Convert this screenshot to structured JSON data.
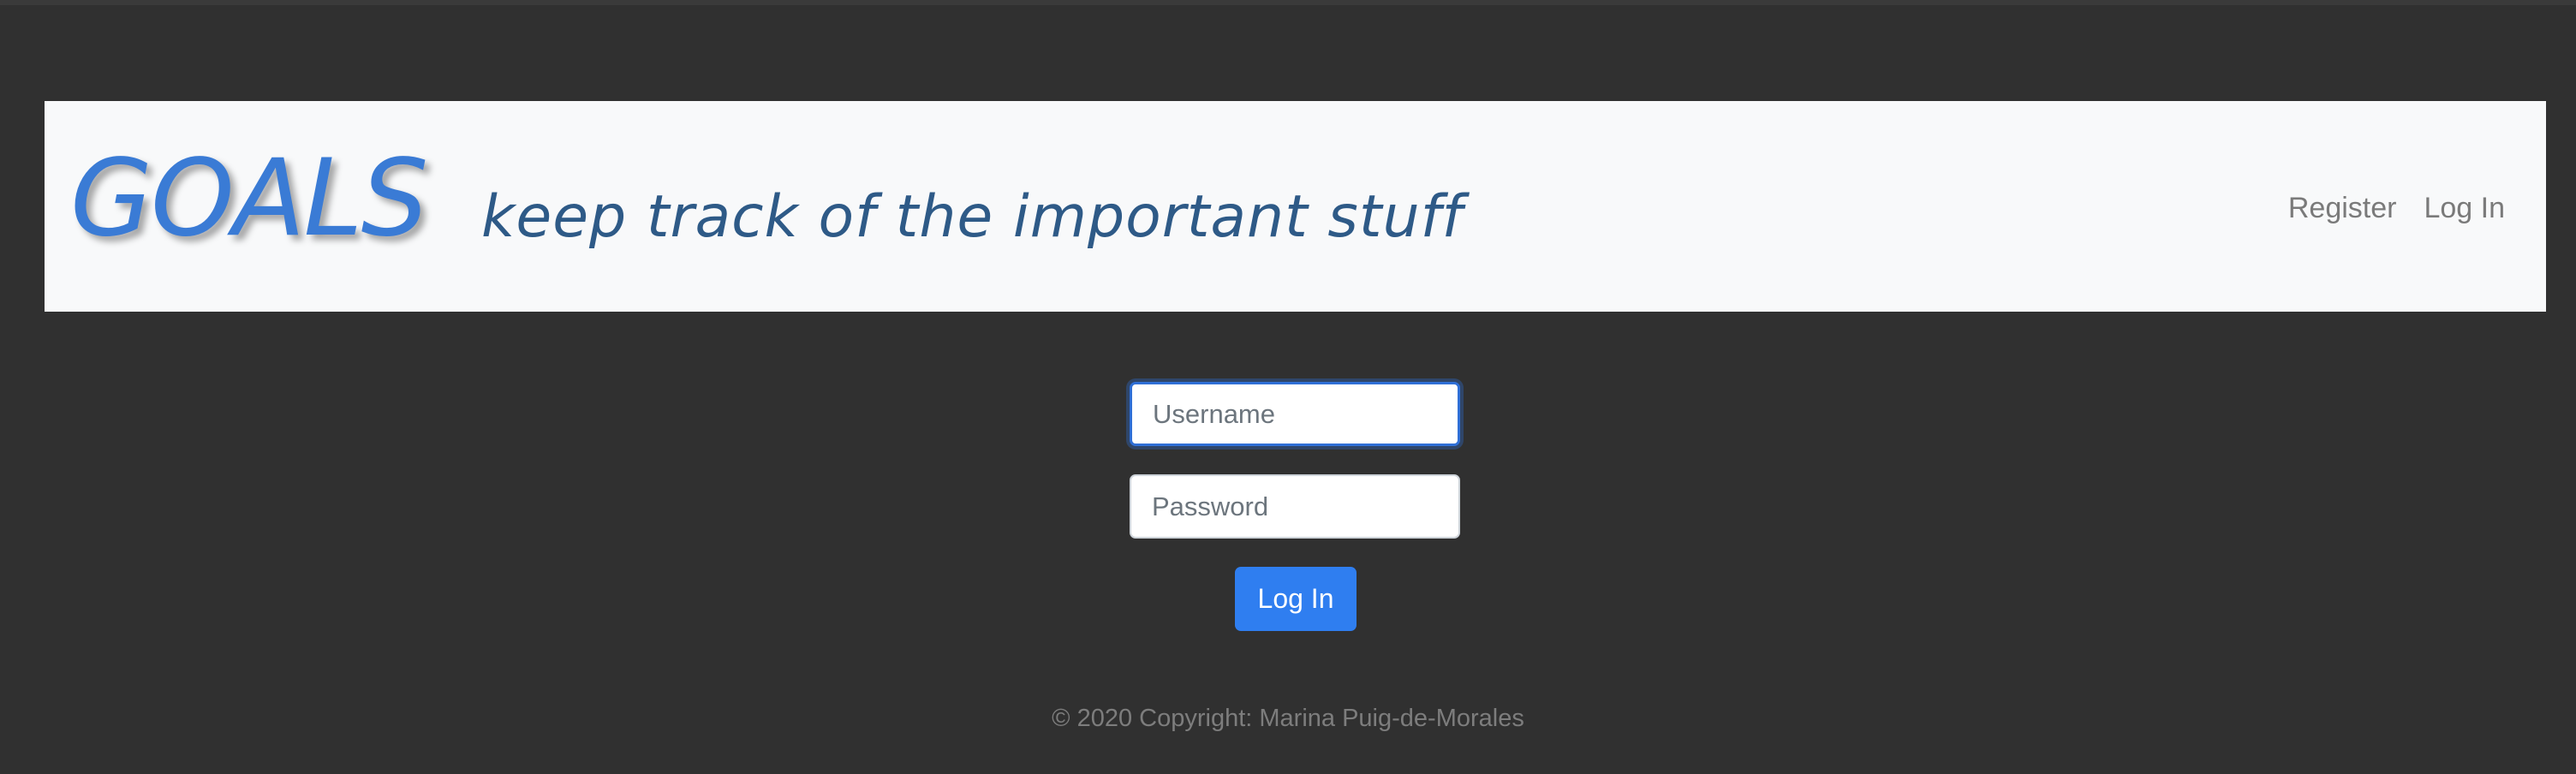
{
  "header": {
    "brand": "GOALS",
    "tagline": "keep track of the important stuff",
    "nav": {
      "register_label": "Register",
      "login_label": "Log In"
    }
  },
  "login_form": {
    "username_placeholder": "Username",
    "password_placeholder": "Password",
    "submit_label": "Log In",
    "focused_field": "username"
  },
  "footer": {
    "copyright": "© 2020 Copyright: Marina Puig-de-Morales"
  },
  "colors": {
    "page_background": "#303030",
    "navbar_background": "#f8f9fa",
    "brand": "#3a7bd5",
    "tagline": "#2e5a87",
    "button": "#2f7ef0",
    "focus_ring": "#2f6fd6"
  }
}
